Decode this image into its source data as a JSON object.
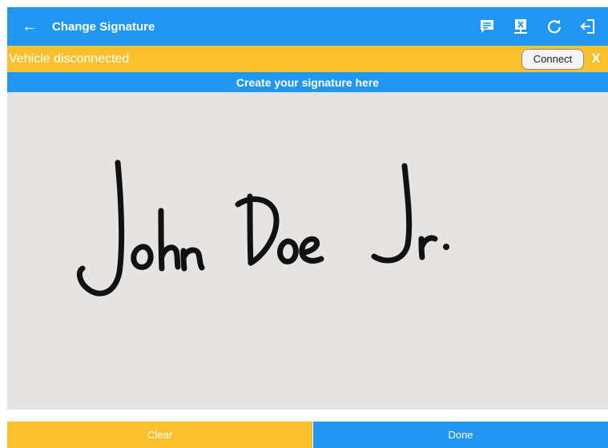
{
  "app_bar": {
    "title": "Change Signature",
    "back_icon": "arrow-left-icon",
    "actions": [
      "message-icon",
      "upload-logs-icon",
      "refresh-icon",
      "logout-icon"
    ]
  },
  "banner": {
    "message": "Vehicle disconnected",
    "connect_label": "Connect",
    "dismiss_label": "X"
  },
  "signature_pad": {
    "header": "Create your signature here",
    "signature_text": "John Doe Jr."
  },
  "footer": {
    "clear_label": "Clear",
    "done_label": "Done"
  },
  "colors": {
    "primary": "#2196f3",
    "warning": "#fbc02d",
    "pad_bg": "#e6e4e3",
    "ink": "#111111"
  }
}
